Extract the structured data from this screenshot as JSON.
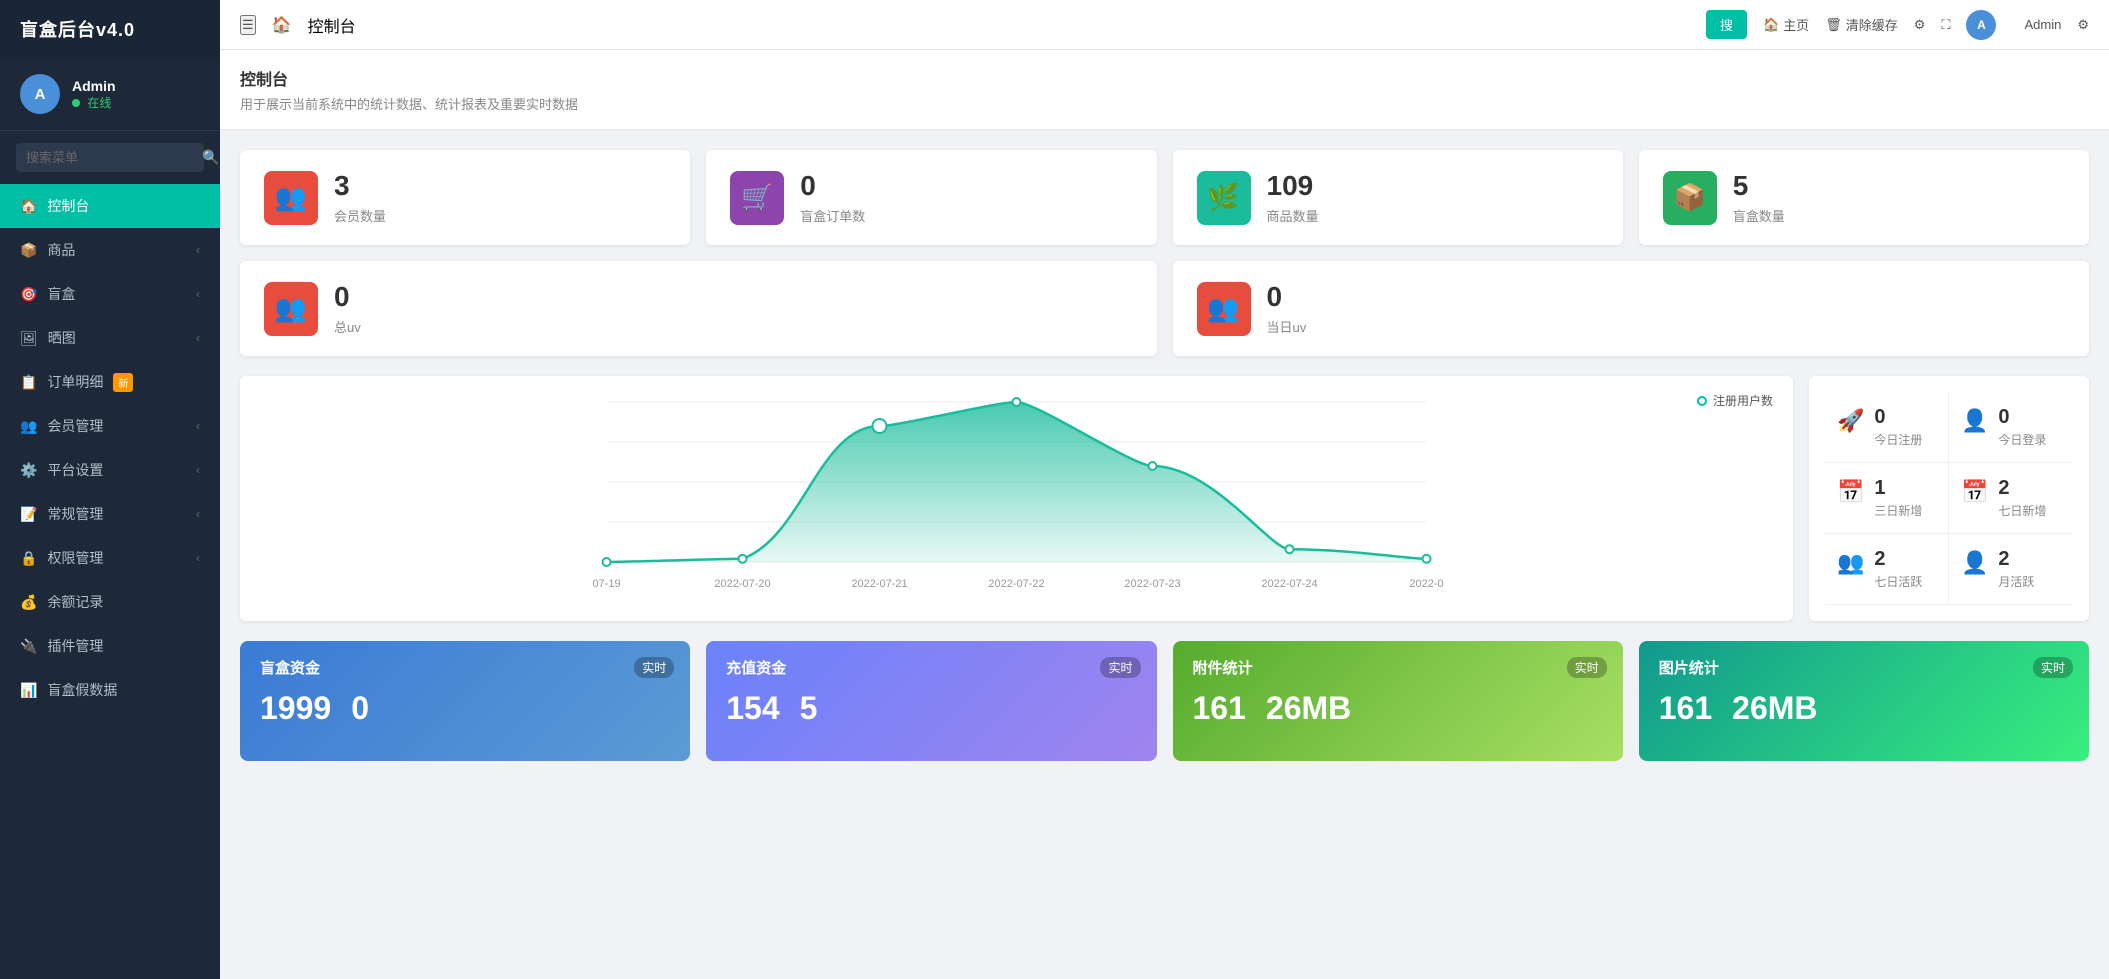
{
  "app": {
    "title": "盲盒后台v4.0"
  },
  "user": {
    "name": "Admin",
    "status": "在线",
    "avatar_initials": "A"
  },
  "sidebar": {
    "search_placeholder": "搜索菜单",
    "items": [
      {
        "id": "dashboard",
        "label": "控制台",
        "icon": "🏠",
        "active": true,
        "badge": ""
      },
      {
        "id": "goods",
        "label": "商品",
        "icon": "📦",
        "active": false,
        "badge": "",
        "has_arrow": true
      },
      {
        "id": "blindbox",
        "label": "盲盒",
        "icon": "🎯",
        "active": false,
        "badge": "",
        "has_arrow": true
      },
      {
        "id": "showmap",
        "label": "晒图",
        "icon": "🖼",
        "active": false,
        "badge": "",
        "has_arrow": true
      },
      {
        "id": "orders",
        "label": "订单明细",
        "icon": "📋",
        "active": false,
        "badge": "新",
        "has_arrow": false
      },
      {
        "id": "members",
        "label": "会员管理",
        "icon": "👥",
        "active": false,
        "badge": "",
        "has_arrow": true
      },
      {
        "id": "settings",
        "label": "平台设置",
        "icon": "⚙️",
        "active": false,
        "badge": "",
        "has_arrow": true
      },
      {
        "id": "general",
        "label": "常规管理",
        "icon": "📝",
        "active": false,
        "badge": "",
        "has_arrow": true
      },
      {
        "id": "permissions",
        "label": "权限管理",
        "icon": "🔒",
        "active": false,
        "badge": "",
        "has_arrow": true
      },
      {
        "id": "balance",
        "label": "余额记录",
        "icon": "💰",
        "active": false,
        "badge": "",
        "has_arrow": false
      },
      {
        "id": "plugins",
        "label": "插件管理",
        "icon": "🔌",
        "active": false,
        "badge": "",
        "has_arrow": false
      },
      {
        "id": "mockdata",
        "label": "盲盒假数据",
        "icon": "📊",
        "active": false,
        "badge": "",
        "has_arrow": false
      }
    ]
  },
  "topbar": {
    "menu_icon": "☰",
    "page_label": "控制台",
    "home_label": "主页",
    "clear_cache_label": "清除缓存",
    "admin_label": "Admin",
    "search_button_label": "搜"
  },
  "page_header": {
    "title": "控制台",
    "subtitle": "用于展示当前系统中的统计数据、统计报表及重要实时数据"
  },
  "stats_row1": [
    {
      "id": "members",
      "value": "3",
      "label": "会员数量",
      "icon": "👥",
      "color": "#e74c3c"
    },
    {
      "id": "orders",
      "value": "0",
      "label": "盲盒订单数",
      "icon": "🛒",
      "color": "#8e44ad"
    },
    {
      "id": "goods",
      "value": "109",
      "label": "商品数量",
      "icon": "🌿",
      "color": "#1abc9c"
    },
    {
      "id": "boxes",
      "value": "5",
      "label": "盲盒数量",
      "icon": "📦",
      "color": "#27ae60"
    }
  ],
  "stats_row2": [
    {
      "id": "total_uv",
      "value": "0",
      "label": "总uv",
      "icon": "👥",
      "color": "#e74c3c"
    },
    {
      "id": "today_uv",
      "value": "0",
      "label": "当日uv",
      "icon": "👥",
      "color": "#e74c3c"
    }
  ],
  "chart": {
    "title": "注册用户数",
    "legend_label": "注册用户数",
    "x_labels": [
      "07-19",
      "2022-07-20",
      "2022-07-21",
      "2022-07-22",
      "2022-07-23",
      "2022-07-24",
      "2022-0"
    ],
    "data_points": [
      0,
      2,
      85,
      100,
      60,
      8,
      2
    ]
  },
  "right_panel": {
    "stats": [
      {
        "id": "today_register",
        "value": "0",
        "label": "今日注册",
        "icon": "🚀"
      },
      {
        "id": "today_login",
        "value": "0",
        "label": "今日登录",
        "icon": "👤"
      },
      {
        "id": "three_day_new",
        "value": "1",
        "label": "三日新增",
        "icon": "📅"
      },
      {
        "id": "seven_day_new",
        "value": "2",
        "label": "七日新增",
        "icon": "📅"
      },
      {
        "id": "seven_day_active",
        "value": "2",
        "label": "七日活跃",
        "icon": "👥"
      },
      {
        "id": "month_active",
        "value": "2",
        "label": "月活跃",
        "icon": "👤"
      }
    ]
  },
  "bottom_cards": [
    {
      "id": "blind_fund",
      "title": "盲盒资金",
      "badge": "实时",
      "values": [
        "1999",
        "0"
      ],
      "color_class": "card-blind-fund"
    },
    {
      "id": "recharge_fund",
      "title": "充值资金",
      "badge": "实时",
      "values": [
        "154",
        "5"
      ],
      "color_class": "card-recharge"
    },
    {
      "id": "attachment_stats",
      "title": "附件统计",
      "badge": "实时",
      "values": [
        "161",
        "26MB"
      ],
      "color_class": "card-attachment"
    },
    {
      "id": "image_stats",
      "title": "图片统计",
      "badge": "实时",
      "values": [
        "161",
        "26MB"
      ],
      "color_class": "card-image"
    }
  ]
}
